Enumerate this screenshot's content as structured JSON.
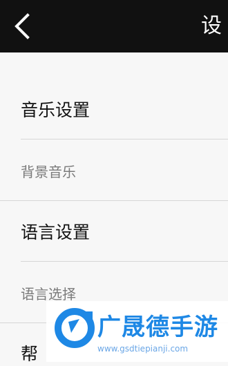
{
  "header": {
    "title": "设",
    "back_icon": "chevron-left-icon"
  },
  "sections": [
    {
      "title": "音乐设置",
      "items": [
        "背景音乐"
      ]
    },
    {
      "title": "语言设置",
      "items": [
        "语言选择"
      ]
    },
    {
      "title": "帮",
      "items": []
    }
  ],
  "watermark": {
    "name": "广晟德手游",
    "url": "www.gsdtiepianji.com",
    "color": "#1e88e5"
  }
}
